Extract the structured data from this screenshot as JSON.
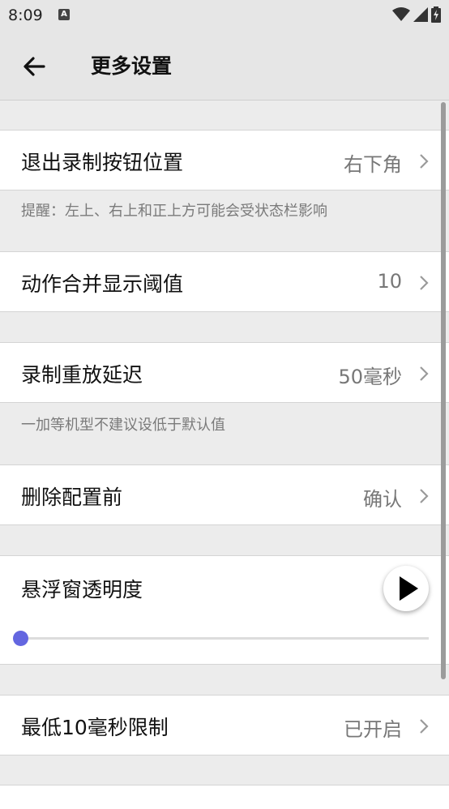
{
  "status": {
    "time": "8:09",
    "notif_icon": "A"
  },
  "header": {
    "title": "更多设置"
  },
  "rows": {
    "exit_button": {
      "label": "退出录制按钮位置",
      "value": "右下角",
      "hint": "提醒：左上、右上和正上方可能会受状态栏影响"
    },
    "merge": {
      "label": "动作合并显示阈值",
      "value": "10"
    },
    "delay": {
      "label": "录制重放延迟",
      "value": "50毫秒",
      "hint": "一加等机型不建议设低于默认值"
    },
    "delete": {
      "label": "删除配置前",
      "value": "确认"
    },
    "opacity": {
      "label": "悬浮窗透明度",
      "slider_fraction": 0.0
    },
    "min_limit": {
      "label": "最低10毫秒限制",
      "value": "已开启"
    }
  },
  "colors": {
    "accent": "#6366e0"
  }
}
